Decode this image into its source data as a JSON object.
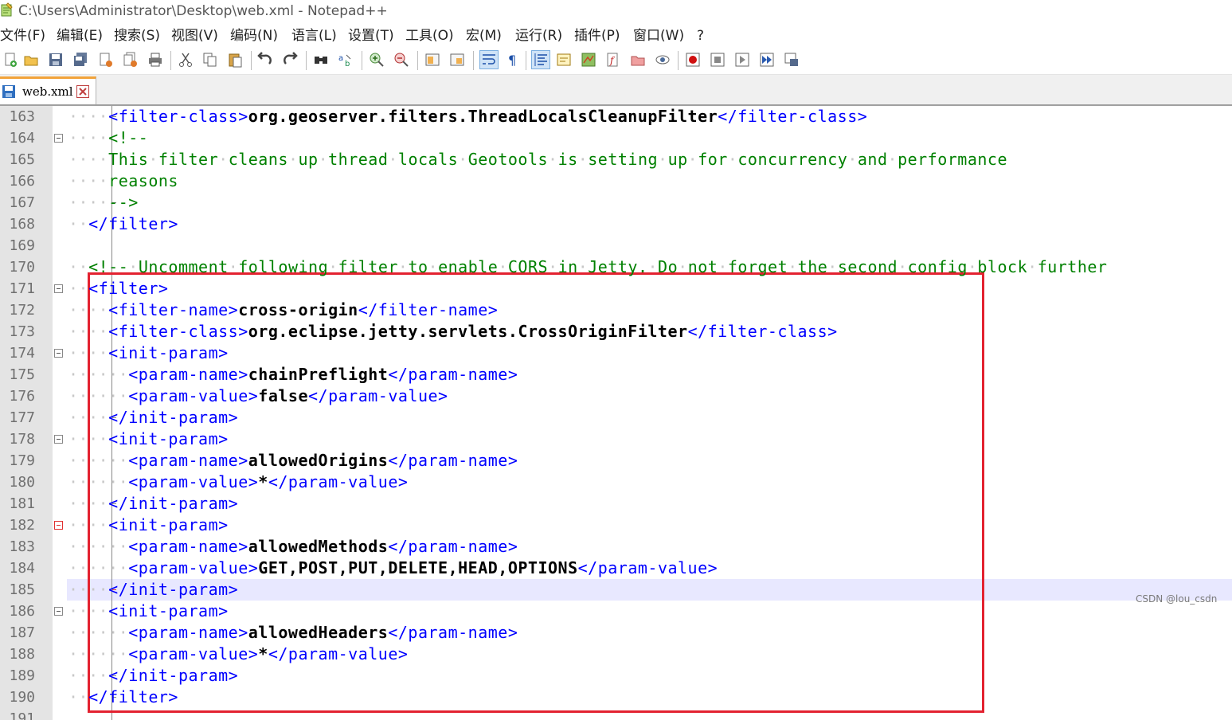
{
  "window": {
    "title": "C:\\Users\\Administrator\\Desktop\\web.xml - Notepad++"
  },
  "menu": [
    "文件(F)",
    "编辑(E)",
    "搜索(S)",
    "视图(V)",
    "编码(N)",
    "语言(L)",
    "设置(T)",
    "工具(O)",
    "宏(M)",
    "运行(R)",
    "插件(P)",
    "窗口(W)",
    "?"
  ],
  "toolbar": {
    "icons": [
      "new-file-icon",
      "open-file-icon",
      "save-icon",
      "save-all-icon",
      "close-icon",
      "close-all-icon",
      "print-icon",
      "cut-icon",
      "copy-icon",
      "paste-icon",
      "undo-icon",
      "redo-icon",
      "find-icon",
      "replace-icon",
      "zoom-in-icon",
      "zoom-out-icon",
      "sync-vertical-icon",
      "sync-horizontal-icon",
      "word-wrap-icon",
      "show-all-chars-icon",
      "indent-guide-icon",
      "user-defined-lang-icon",
      "doc-map-icon",
      "function-list-icon",
      "folder-workspace-icon",
      "monitoring-icon",
      "record-macro-icon",
      "stop-record-icon",
      "play-macro-icon",
      "run-macro-multiple-icon",
      "save-macro-icon"
    ]
  },
  "tabs": [
    {
      "label": "web.xml",
      "active": true
    }
  ],
  "editor": {
    "current_line": 185,
    "lines": [
      {
        "n": "163",
        "d": "····",
        "p": [
          [
            "tg",
            "<filter-class>"
          ],
          [
            "tx",
            "org.geoserver.filters.ThreadLocalsCleanupFilter"
          ],
          [
            "tg",
            "</filter-class>"
          ]
        ]
      },
      {
        "n": "164",
        "d": "····",
        "p": [
          [
            "cm",
            "<!--"
          ]
        ]
      },
      {
        "n": "165",
        "d": "····",
        "p": [
          [
            "cm",
            "This filter cleans up thread locals Geotools is setting up for concurrency and performance"
          ]
        ]
      },
      {
        "n": "166",
        "d": "····",
        "p": [
          [
            "cm",
            "reasons"
          ]
        ]
      },
      {
        "n": "167",
        "d": "····",
        "p": [
          [
            "cm",
            "-->"
          ]
        ]
      },
      {
        "n": "168",
        "d": "··",
        "p": [
          [
            "tg",
            "</filter>"
          ]
        ]
      },
      {
        "n": "169",
        "d": "",
        "p": []
      },
      {
        "n": "170",
        "d": "··",
        "p": [
          [
            "cm",
            "<!-- Uncomment following filter to enable CORS in Jetty. Do not forget the second config block further"
          ]
        ]
      },
      {
        "n": "171",
        "d": "··",
        "p": [
          [
            "tg",
            "<filter>"
          ]
        ]
      },
      {
        "n": "172",
        "d": "····",
        "p": [
          [
            "tg",
            "<filter-name>"
          ],
          [
            "tx",
            "cross-origin"
          ],
          [
            "tg",
            "</filter-name>"
          ]
        ]
      },
      {
        "n": "173",
        "d": "····",
        "p": [
          [
            "tg",
            "<filter-class>"
          ],
          [
            "tx",
            "org.eclipse.jetty.servlets.CrossOriginFilter"
          ],
          [
            "tg",
            "</filter-class>"
          ]
        ]
      },
      {
        "n": "174",
        "d": "····",
        "p": [
          [
            "tg",
            "<init-param>"
          ]
        ]
      },
      {
        "n": "175",
        "d": "······",
        "p": [
          [
            "tg",
            "<param-name>"
          ],
          [
            "tx",
            "chainPreflight"
          ],
          [
            "tg",
            "</param-name>"
          ]
        ]
      },
      {
        "n": "176",
        "d": "······",
        "p": [
          [
            "tg",
            "<param-value>"
          ],
          [
            "tx",
            "false"
          ],
          [
            "tg",
            "</param-value>"
          ]
        ]
      },
      {
        "n": "177",
        "d": "····",
        "p": [
          [
            "tg",
            "</init-param>"
          ]
        ]
      },
      {
        "n": "178",
        "d": "····",
        "p": [
          [
            "tg",
            "<init-param>"
          ]
        ]
      },
      {
        "n": "179",
        "d": "······",
        "p": [
          [
            "tg",
            "<param-name>"
          ],
          [
            "tx",
            "allowedOrigins"
          ],
          [
            "tg",
            "</param-name>"
          ]
        ]
      },
      {
        "n": "180",
        "d": "······",
        "p": [
          [
            "tg",
            "<param-value>"
          ],
          [
            "tx",
            "*"
          ],
          [
            "tg",
            "</param-value>"
          ]
        ]
      },
      {
        "n": "181",
        "d": "····",
        "p": [
          [
            "tg",
            "</init-param>"
          ]
        ]
      },
      {
        "n": "182",
        "d": "····",
        "p": [
          [
            "tg",
            "<init-param>"
          ]
        ]
      },
      {
        "n": "183",
        "d": "······",
        "p": [
          [
            "tg",
            "<param-name>"
          ],
          [
            "tx",
            "allowedMethods"
          ],
          [
            "tg",
            "</param-name>"
          ]
        ]
      },
      {
        "n": "184",
        "d": "······",
        "p": [
          [
            "tg",
            "<param-value>"
          ],
          [
            "tx",
            "GET,POST,PUT,DELETE,HEAD,OPTIONS"
          ],
          [
            "tg",
            "</param-value>"
          ]
        ]
      },
      {
        "n": "185",
        "d": "····",
        "p": [
          [
            "tg",
            "</init-param>"
          ]
        ]
      },
      {
        "n": "186",
        "d": "····",
        "p": [
          [
            "tg",
            "<init-param>"
          ]
        ]
      },
      {
        "n": "187",
        "d": "······",
        "p": [
          [
            "tg",
            "<param-name>"
          ],
          [
            "tx",
            "allowedHeaders"
          ],
          [
            "tg",
            "</param-name>"
          ]
        ]
      },
      {
        "n": "188",
        "d": "······",
        "p": [
          [
            "tg",
            "<param-value>"
          ],
          [
            "tx",
            "*"
          ],
          [
            "tg",
            "</param-value>"
          ]
        ]
      },
      {
        "n": "189",
        "d": "····",
        "p": [
          [
            "tg",
            "</init-param>"
          ]
        ]
      },
      {
        "n": "190",
        "d": "··",
        "p": [
          [
            "tg",
            "</filter>"
          ]
        ]
      },
      {
        "n": "191",
        "d": "",
        "p": []
      }
    ]
  },
  "watermark": "CSDN @lou_csdn",
  "colors": {
    "tag": "#0000ff",
    "text": "#000000",
    "comment": "#008000",
    "annotation_box": "#e32230",
    "current_line_bg": "#e8e8ff",
    "tab_accent": "#f2a33a"
  }
}
